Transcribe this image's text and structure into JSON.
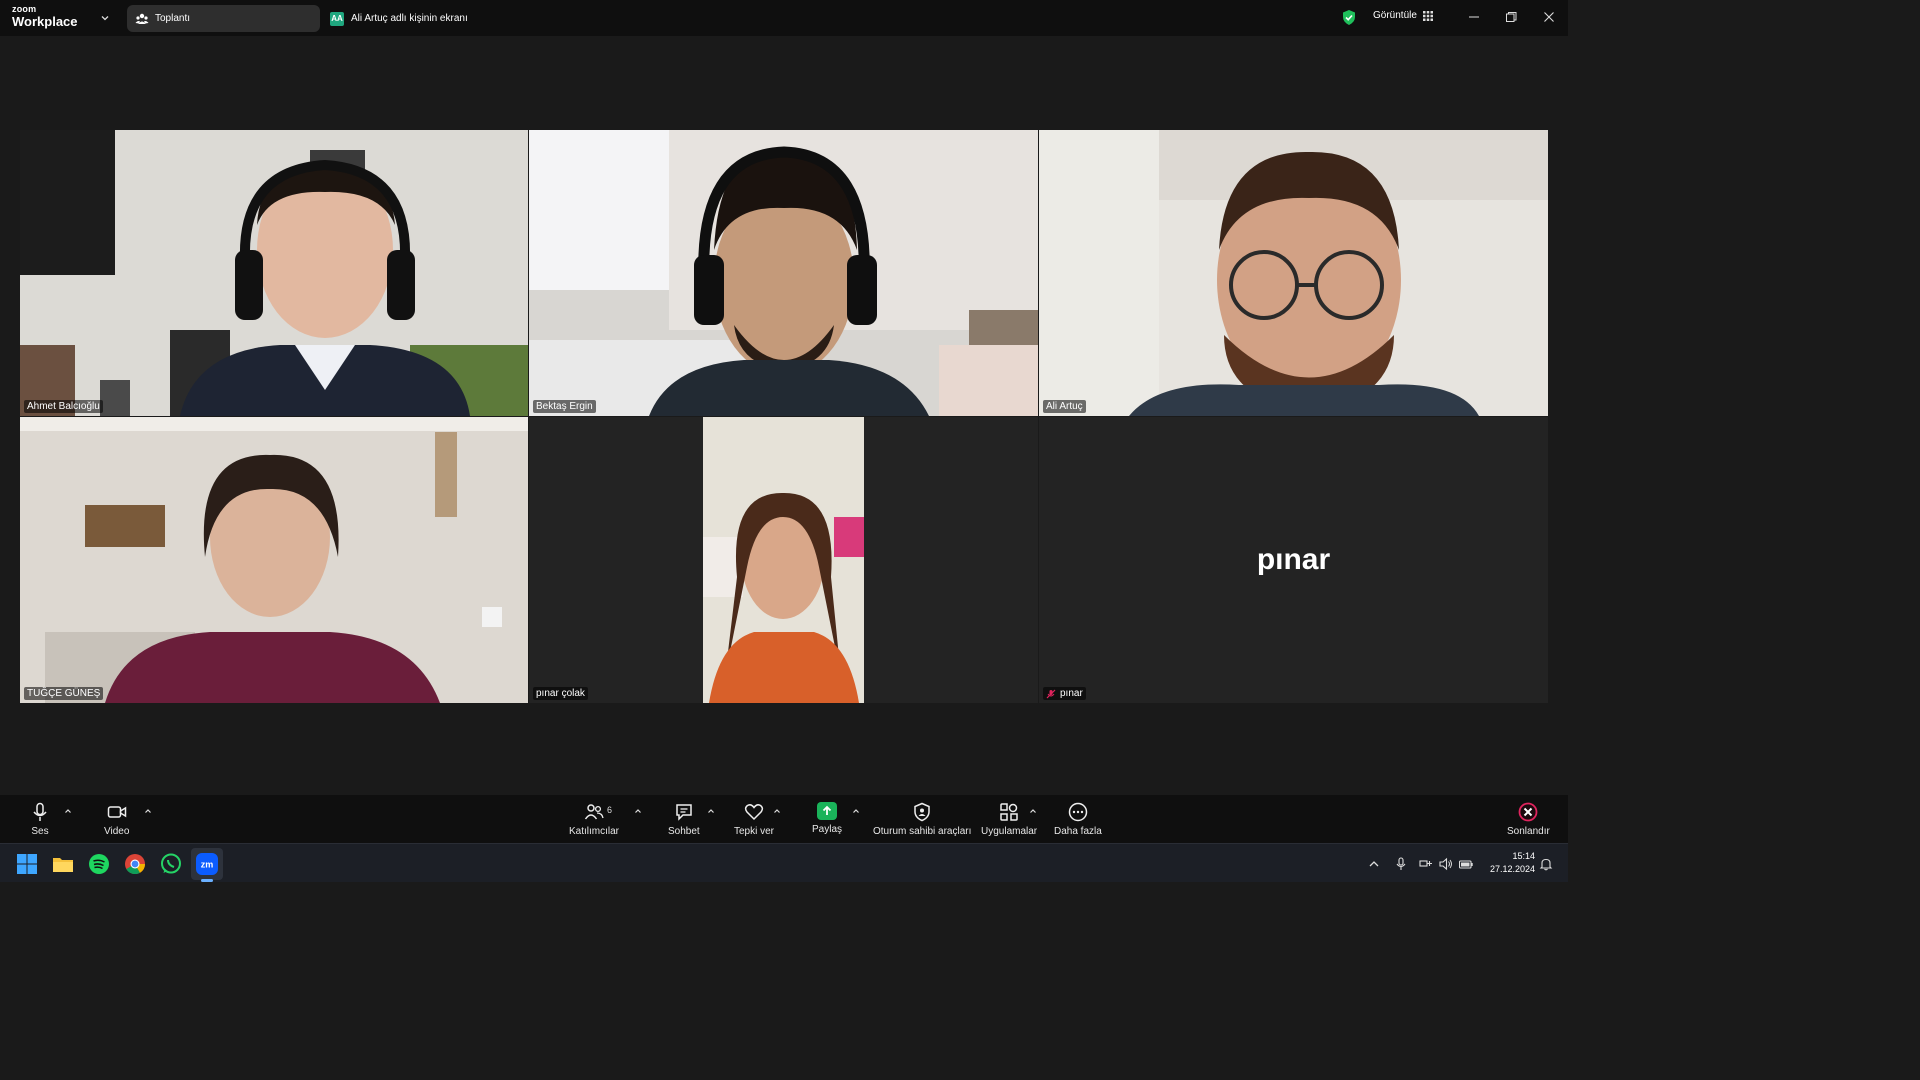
{
  "titlebar": {
    "brand_small": "zoom",
    "brand_big": "Workplace",
    "meeting_tab_label": "Toplantı",
    "share_tab_badge": "AA",
    "share_tab_label": "Ali Artuç adlı kişinin ekranı",
    "view_label": "Görüntüle"
  },
  "participants": [
    {
      "name": "Ahmet Balcıoğlu",
      "video": true,
      "active": false
    },
    {
      "name": "Bektaş Ergin",
      "video": true,
      "active": true
    },
    {
      "name": "Ali Artuç",
      "video": true,
      "active": false
    },
    {
      "name": "TUĞÇE GÜNEŞ",
      "video": true,
      "active": false
    },
    {
      "name": "pınar çolak",
      "video": true,
      "active": false
    },
    {
      "name": "pınar",
      "video": false,
      "active": false,
      "muted": true,
      "display_name": "pınar"
    }
  ],
  "toolbar": {
    "audio_label": "Ses",
    "video_label": "Video",
    "participants_label": "Katılımcılar",
    "participants_count": "6",
    "chat_label": "Sohbet",
    "react_label": "Tepki ver",
    "share_label": "Paylaş",
    "host_tools_label": "Oturum sahibi araçları",
    "apps_label": "Uygulamalar",
    "more_label": "Daha fazla",
    "end_label": "Sonlandır"
  },
  "taskbar": {
    "apps": [
      "windows-start",
      "file-explorer",
      "spotify",
      "chrome",
      "whatsapp",
      "zoom"
    ],
    "time": "15:14",
    "date": "27.12.2024"
  },
  "colors": {
    "active_speaker": "#2bd48a",
    "share_green": "#1ab35a",
    "end_red": "#e0245e",
    "security_green": "#1fbf5b"
  }
}
